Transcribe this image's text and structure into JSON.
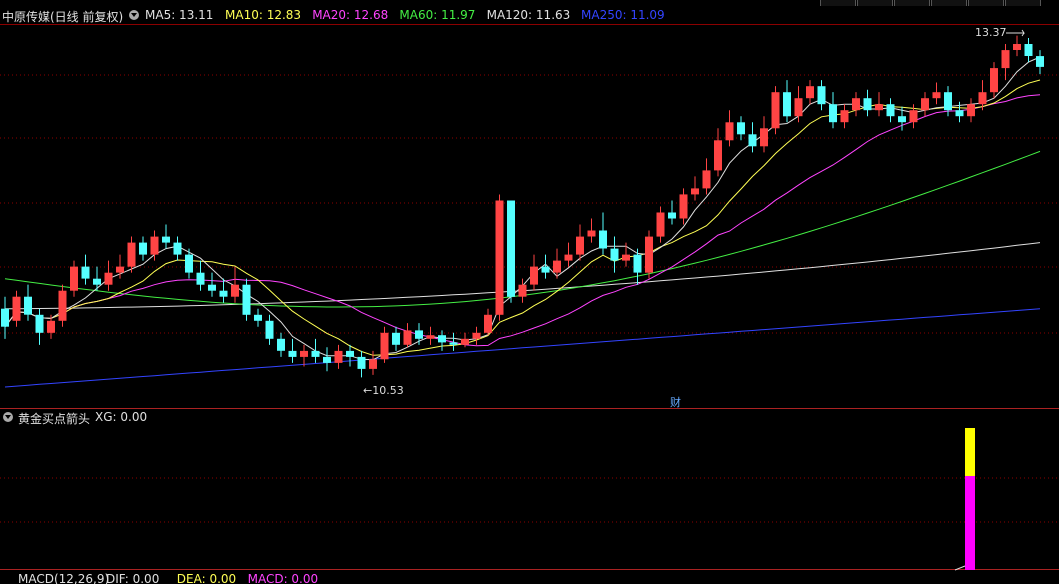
{
  "header": {
    "stock_title": "中原传媒(日线 前复权)",
    "indicators": [
      {
        "label": "MA5: 13.11",
        "color": "#e0e0e0"
      },
      {
        "label": "MA10: 12.83",
        "color": "#ffff55"
      },
      {
        "label": "MA20: 12.68",
        "color": "#ff44ff"
      },
      {
        "label": "MA60: 11.97",
        "color": "#44ee44"
      },
      {
        "label": "MA120: 11.63",
        "color": "#e0e0e0"
      },
      {
        "label": "MA250: 11.09",
        "color": "#3344ff"
      }
    ]
  },
  "annotations": {
    "high_label": "13.37",
    "low_label": "←10.53",
    "event_marker": "财"
  },
  "sub_indicator": {
    "title": "黄金买点箭头",
    "value": "XG: 0.00"
  },
  "macd_header": {
    "title": "MACD(12,26,9)",
    "items": [
      {
        "label": "DIF: 0.00",
        "color": "#e0e0e0"
      },
      {
        "label": "DEA: 0.00",
        "color": "#ffff55"
      },
      {
        "label": "MACD: 0.00",
        "color": "#ff44ff"
      }
    ]
  },
  "colors": {
    "up": "#ff4444",
    "down": "#55ffff",
    "grid": "#8b0000",
    "ma5": "#e0e0e0",
    "ma10": "#ffff55",
    "ma20": "#ff44ff",
    "ma60": "#44ee44",
    "ma120": "#e0e0e0",
    "ma250": "#3344ff"
  },
  "chart_data": {
    "type": "candlestick",
    "title": "中原传媒(日线 前复权)",
    "annotated_high": 13.37,
    "annotated_low": 10.53,
    "candles": [
      [
        11.1,
        10.95,
        11.2,
        10.85
      ],
      [
        11.0,
        11.2,
        11.25,
        10.95
      ],
      [
        11.2,
        11.05,
        11.3,
        11.0
      ],
      [
        11.05,
        10.9,
        11.1,
        10.8
      ],
      [
        10.9,
        11.0,
        11.05,
        10.85
      ],
      [
        11.0,
        11.25,
        11.3,
        10.95
      ],
      [
        11.25,
        11.45,
        11.5,
        11.2
      ],
      [
        11.45,
        11.35,
        11.55,
        11.3
      ],
      [
        11.35,
        11.3,
        11.45,
        11.25
      ],
      [
        11.3,
        11.4,
        11.5,
        11.25
      ],
      [
        11.4,
        11.45,
        11.55,
        11.35
      ],
      [
        11.45,
        11.65,
        11.7,
        11.4
      ],
      [
        11.65,
        11.55,
        11.7,
        11.5
      ],
      [
        11.55,
        11.7,
        11.75,
        11.5
      ],
      [
        11.7,
        11.65,
        11.8,
        11.6
      ],
      [
        11.65,
        11.55,
        11.7,
        11.5
      ],
      [
        11.55,
        11.4,
        11.6,
        11.35
      ],
      [
        11.4,
        11.3,
        11.5,
        11.25
      ],
      [
        11.3,
        11.25,
        11.4,
        11.2
      ],
      [
        11.25,
        11.2,
        11.35,
        11.15
      ],
      [
        11.2,
        11.3,
        11.45,
        11.15
      ],
      [
        11.3,
        11.05,
        11.35,
        11.0
      ],
      [
        11.05,
        11.0,
        11.1,
        10.95
      ],
      [
        11.0,
        10.85,
        11.05,
        10.8
      ],
      [
        10.85,
        10.75,
        10.9,
        10.7
      ],
      [
        10.75,
        10.7,
        10.85,
        10.65
      ],
      [
        10.7,
        10.75,
        10.8,
        10.62
      ],
      [
        10.75,
        10.7,
        10.85,
        10.65
      ],
      [
        10.7,
        10.65,
        10.78,
        10.58
      ],
      [
        10.65,
        10.75,
        10.8,
        10.6
      ],
      [
        10.75,
        10.7,
        10.8,
        10.62
      ],
      [
        10.7,
        10.6,
        10.75,
        10.53
      ],
      [
        10.6,
        10.68,
        10.75,
        10.55
      ],
      [
        10.68,
        10.9,
        10.95,
        10.65
      ],
      [
        10.9,
        10.8,
        10.95,
        10.75
      ],
      [
        10.8,
        10.92,
        10.98,
        10.78
      ],
      [
        10.92,
        10.85,
        10.98,
        10.8
      ],
      [
        10.85,
        10.88,
        10.95,
        10.8
      ],
      [
        10.88,
        10.82,
        10.92,
        10.75
      ],
      [
        10.82,
        10.8,
        10.9,
        10.75
      ],
      [
        10.8,
        10.85,
        10.9,
        10.78
      ],
      [
        10.85,
        10.9,
        10.95,
        10.8
      ],
      [
        10.9,
        11.05,
        11.1,
        10.88
      ],
      [
        11.05,
        12.0,
        12.05,
        11.0
      ],
      [
        12.0,
        11.2,
        12.0,
        11.15
      ],
      [
        11.2,
        11.3,
        11.35,
        11.15
      ],
      [
        11.3,
        11.45,
        11.55,
        11.25
      ],
      [
        11.45,
        11.4,
        11.55,
        11.35
      ],
      [
        11.4,
        11.5,
        11.6,
        11.35
      ],
      [
        11.5,
        11.55,
        11.65,
        11.45
      ],
      [
        11.55,
        11.7,
        11.8,
        11.5
      ],
      [
        11.7,
        11.75,
        11.85,
        11.65
      ],
      [
        11.75,
        11.6,
        11.9,
        11.55
      ],
      [
        11.6,
        11.5,
        11.7,
        11.4
      ],
      [
        11.5,
        11.55,
        11.65,
        11.45
      ],
      [
        11.55,
        11.4,
        11.6,
        11.3
      ],
      [
        11.4,
        11.7,
        11.75,
        11.35
      ],
      [
        11.7,
        11.9,
        11.95,
        11.65
      ],
      [
        11.9,
        11.85,
        12.0,
        11.8
      ],
      [
        11.85,
        12.05,
        12.1,
        11.8
      ],
      [
        12.05,
        12.1,
        12.2,
        12.0
      ],
      [
        12.1,
        12.25,
        12.35,
        12.05
      ],
      [
        12.25,
        12.5,
        12.6,
        12.2
      ],
      [
        12.5,
        12.65,
        12.75,
        12.45
      ],
      [
        12.65,
        12.55,
        12.7,
        12.5
      ],
      [
        12.55,
        12.45,
        12.65,
        12.4
      ],
      [
        12.45,
        12.6,
        12.7,
        12.4
      ],
      [
        12.6,
        12.9,
        12.95,
        12.55
      ],
      [
        12.9,
        12.7,
        13.0,
        12.65
      ],
      [
        12.7,
        12.85,
        12.95,
        12.65
      ],
      [
        12.85,
        12.95,
        13.0,
        12.8
      ],
      [
        12.95,
        12.8,
        13.0,
        12.75
      ],
      [
        12.8,
        12.65,
        12.9,
        12.6
      ],
      [
        12.65,
        12.75,
        12.8,
        12.6
      ],
      [
        12.75,
        12.85,
        12.9,
        12.7
      ],
      [
        12.85,
        12.75,
        12.92,
        12.7
      ],
      [
        12.75,
        12.8,
        12.9,
        12.7
      ],
      [
        12.8,
        12.7,
        12.85,
        12.65
      ],
      [
        12.7,
        12.65,
        12.78,
        12.58
      ],
      [
        12.65,
        12.75,
        12.8,
        12.6
      ],
      [
        12.75,
        12.85,
        12.9,
        12.7
      ],
      [
        12.85,
        12.9,
        12.98,
        12.8
      ],
      [
        12.9,
        12.75,
        12.95,
        12.7
      ],
      [
        12.75,
        12.7,
        12.82,
        12.65
      ],
      [
        12.7,
        12.8,
        12.85,
        12.65
      ],
      [
        12.8,
        12.9,
        13.0,
        12.75
      ],
      [
        12.9,
        13.1,
        13.15,
        12.85
      ],
      [
        13.1,
        13.25,
        13.3,
        13.0
      ],
      [
        13.25,
        13.3,
        13.37,
        13.2
      ],
      [
        13.3,
        13.2,
        13.35,
        13.15
      ],
      [
        13.2,
        13.11,
        13.25,
        13.05
      ]
    ]
  }
}
